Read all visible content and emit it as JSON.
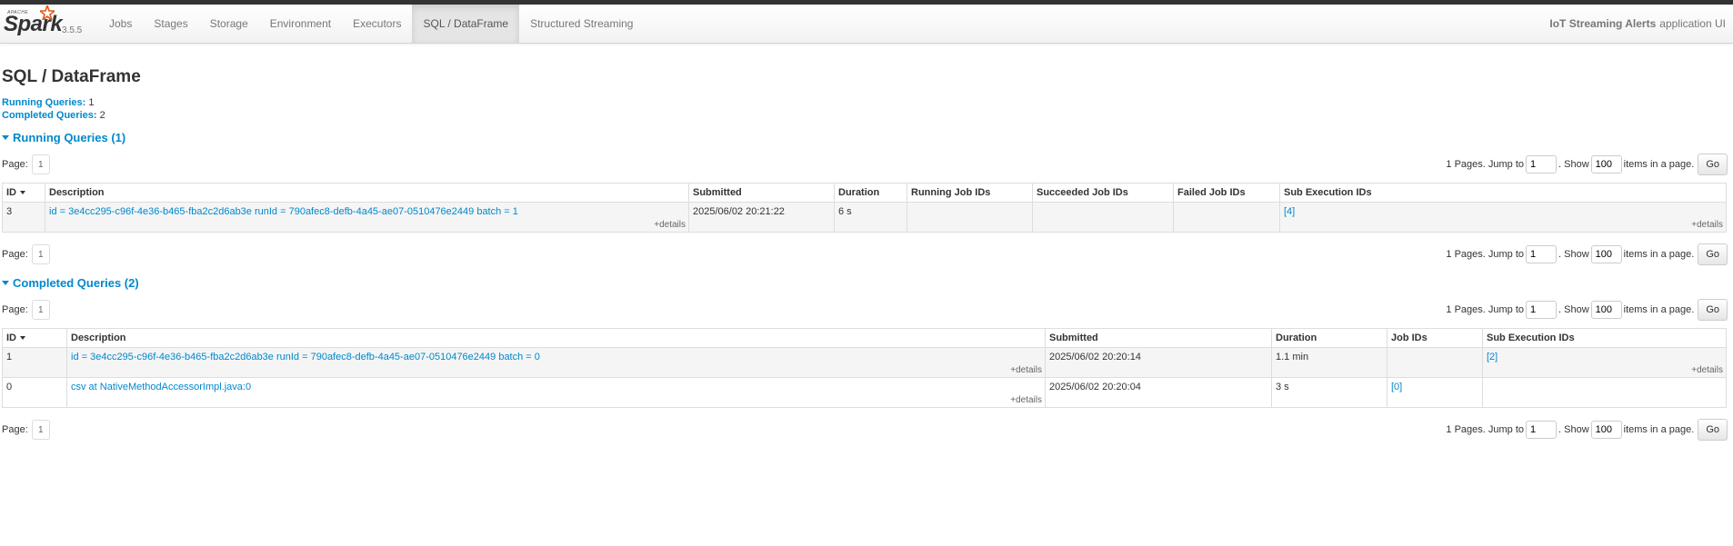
{
  "navbar": {
    "brand_apache": "APACHE",
    "brand_name": "Spark",
    "version": "3.5.5",
    "tabs": [
      "Jobs",
      "Stages",
      "Storage",
      "Environment",
      "Executors",
      "SQL / DataFrame",
      "Structured Streaming"
    ],
    "app_name": "IoT Streaming Alerts",
    "app_suffix": "application UI"
  },
  "page": {
    "title": "SQL / DataFrame",
    "summary": [
      {
        "label": "Running Queries:",
        "value": "1"
      },
      {
        "label": "Completed Queries:",
        "value": "2"
      }
    ]
  },
  "pager": {
    "page_label": "Page:",
    "page_value": "1",
    "pages_text": "1 Pages. Jump to",
    "jump_value": "1",
    "show_text": ". Show",
    "show_value": "100",
    "items_text": "items in a page.",
    "go_label": "Go"
  },
  "running": {
    "heading": "Running Queries (1)",
    "headers": [
      "ID",
      "Description",
      "Submitted",
      "Duration",
      "Running Job IDs",
      "Succeeded Job IDs",
      "Failed Job IDs",
      "Sub Execution IDs"
    ],
    "rows": [
      {
        "id": "3",
        "description": "id = 3e4cc295-c96f-4e36-b465-fba2c2d6ab3e runId = 790afec8-defb-4a45-ae07-0510476e2449 batch = 1",
        "details": "+details",
        "submitted": "2025/06/02 20:21:22",
        "duration": "6 s",
        "running_jobs": "",
        "succeeded_jobs": "",
        "failed_jobs": "",
        "sub_exec": "[4]",
        "sub_details": "+details"
      }
    ]
  },
  "completed": {
    "heading": "Completed Queries (2)",
    "headers": [
      "ID",
      "Description",
      "Submitted",
      "Duration",
      "Job IDs",
      "Sub Execution IDs"
    ],
    "rows": [
      {
        "id": "1",
        "description": "id = 3e4cc295-c96f-4e36-b465-fba2c2d6ab3e runId = 790afec8-defb-4a45-ae07-0510476e2449 batch = 0",
        "details": "+details",
        "submitted": "2025/06/02 20:20:14",
        "duration": "1.1 min",
        "job_ids": "",
        "sub_exec": "[2]",
        "sub_details": "+details"
      },
      {
        "id": "0",
        "description": "csv at NativeMethodAccessorImpl.java:0",
        "details": "+details",
        "submitted": "2025/06/02 20:20:04",
        "duration": "3 s",
        "job_ids": "[0]",
        "sub_exec": "",
        "sub_details": ""
      }
    ]
  },
  "colors": {
    "link": "#0088cc",
    "nav_active_bg": "#e5e5e5",
    "topbar": "#333333"
  }
}
